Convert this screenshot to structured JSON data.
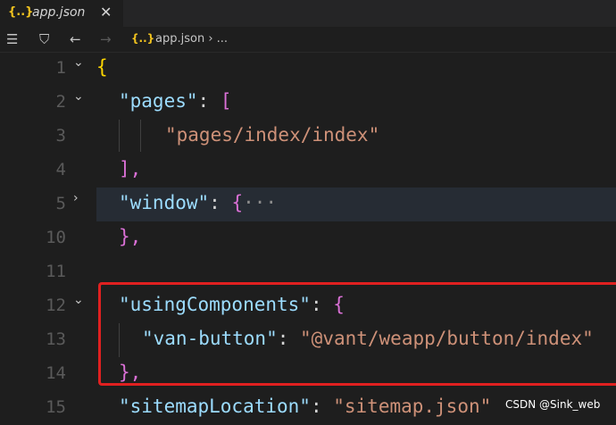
{
  "tab": {
    "icon": "{..}",
    "label": "app.json",
    "close": "✕"
  },
  "breadcrumb": {
    "json_icon": "{..}",
    "file": "app.json",
    "separator": "›",
    "ellipsis": "..."
  },
  "lines": [
    {
      "num": "1"
    },
    {
      "num": "2"
    },
    {
      "num": "3"
    },
    {
      "num": "4"
    },
    {
      "num": "5"
    },
    {
      "num": "10"
    },
    {
      "num": "11"
    },
    {
      "num": "12"
    },
    {
      "num": "13"
    },
    {
      "num": "14"
    },
    {
      "num": "15"
    }
  ],
  "code": {
    "l1_open": "{",
    "pages_key": "\"pages\"",
    "colon": ":",
    "pages_open": "[",
    "pages_value": "\"pages/index/index\"",
    "pages_close": "],",
    "window_key": "\"window\"",
    "window_open": "{",
    "window_folded": "···",
    "window_close": "},",
    "using_key": "\"usingComponents\"",
    "using_open": "{",
    "van_key": "\"van-button\"",
    "van_value": "\"@vant/weapp/button/index\"",
    "using_close": "},",
    "sitemap_key": "\"sitemapLocation\"",
    "sitemap_value": "\"sitemap.json\""
  },
  "watermark": "CSDN @Sink_web",
  "colors": {
    "key": "#9cdcfe",
    "string": "#ce9178",
    "bracket1": "#ffd700",
    "bracket2": "#da70d6",
    "highlight_box": "#e02020"
  }
}
